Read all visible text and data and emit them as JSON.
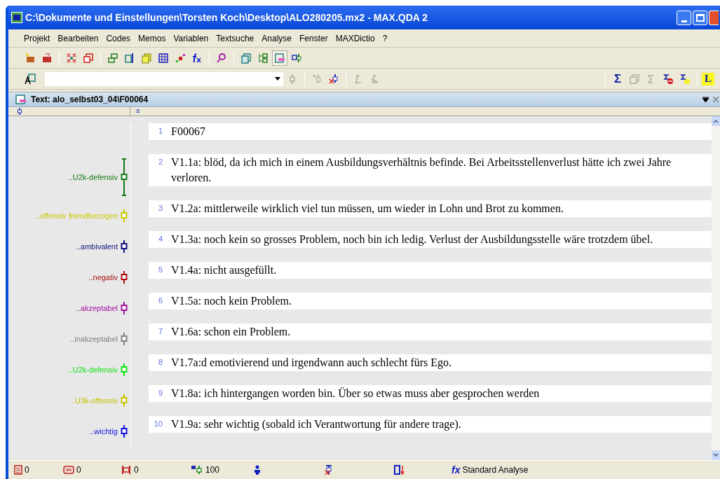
{
  "window": {
    "title": "C:\\Dokumente und Einstellungen\\Torsten Koch\\Desktop\\ALO280205.mx2 - MAX.QDA 2"
  },
  "menu": [
    "Projekt",
    "Bearbeiten",
    "Codes",
    "Memos",
    "Variablen",
    "Textsuche",
    "Analyse",
    "Fenster",
    "MAXDictio",
    "?"
  ],
  "toolbar2": {
    "sigma_icon": "Σ",
    "l_icon": "L"
  },
  "panel": {
    "title": "Text: alo_selbst03_04\\F00064",
    "header_glyph": "≡"
  },
  "lines": [
    {
      "number": "1",
      "text": "F00067"
    },
    {
      "number": "2",
      "text": "V1.1a: blöd, da ich mich in einem Ausbildungsverhältnis befinde. Bei Arbeitsstellenverlust hätte ich zwei Jahre verloren.",
      "code": {
        "label": "..U2k-defensiv",
        "color": "#137a13"
      }
    },
    {
      "number": "3",
      "text": "V1.2a: mittlerweile wirklich viel tun müssen, um wieder in Lohn und Brot zu kommen.",
      "code": {
        "label": "..offensiv fremdbezogen",
        "color": "#c8c800"
      }
    },
    {
      "number": "4",
      "text": "V1.3a: noch kein so grosses Problem, noch bin ich ledig. Verlust der Ausbildungsstelle wäre trotzdem übel.",
      "code": {
        "label": "..ambivalent",
        "color": "#101080"
      }
    },
    {
      "number": "5",
      "text": "V1.4a: nicht ausgefüllt.",
      "code": {
        "label": "..negativ",
        "color": "#a81010"
      }
    },
    {
      "number": "6",
      "text": "V1.5a: noch kein Problem.",
      "code": {
        "label": "..akzeptabel",
        "color": "#a010a0"
      }
    },
    {
      "number": "7",
      "text": "V1.6a: schon ein Problem.",
      "code": {
        "label": "..inakzeptabel",
        "color": "#808080"
      }
    },
    {
      "number": "8",
      "text": "V1.7a:d emotivierend und irgendwann auch schlecht fürs Ego.",
      "code": {
        "label": "..U2k-defensiv",
        "color": "#10e010"
      }
    },
    {
      "number": "9",
      "text": "V1.8a: ich hintergangen worden bin. Über so etwas muss aber gesprochen werden",
      "code": {
        "label": "..U3k-offensiv",
        "color": "#c8c000"
      }
    },
    {
      "number": "10",
      "text": "V1.9a: sehr wichtig (sobald ich Verantwortung für andere trage).",
      "code": {
        "label": "..wichtig",
        "color": "#1010e0"
      }
    }
  ],
  "status_bar": [
    {
      "kind": "documents",
      "text": "0"
    },
    {
      "kind": "memos",
      "text": "0"
    },
    {
      "kind": "codes",
      "text": "0"
    },
    {
      "kind": "segments",
      "text": "100"
    },
    {
      "kind": "person"
    },
    {
      "kind": "deactivate"
    },
    {
      "kind": "sort"
    },
    {
      "kind": "analysis",
      "icon_text": "fx",
      "text": "Standard Analyse"
    }
  ]
}
